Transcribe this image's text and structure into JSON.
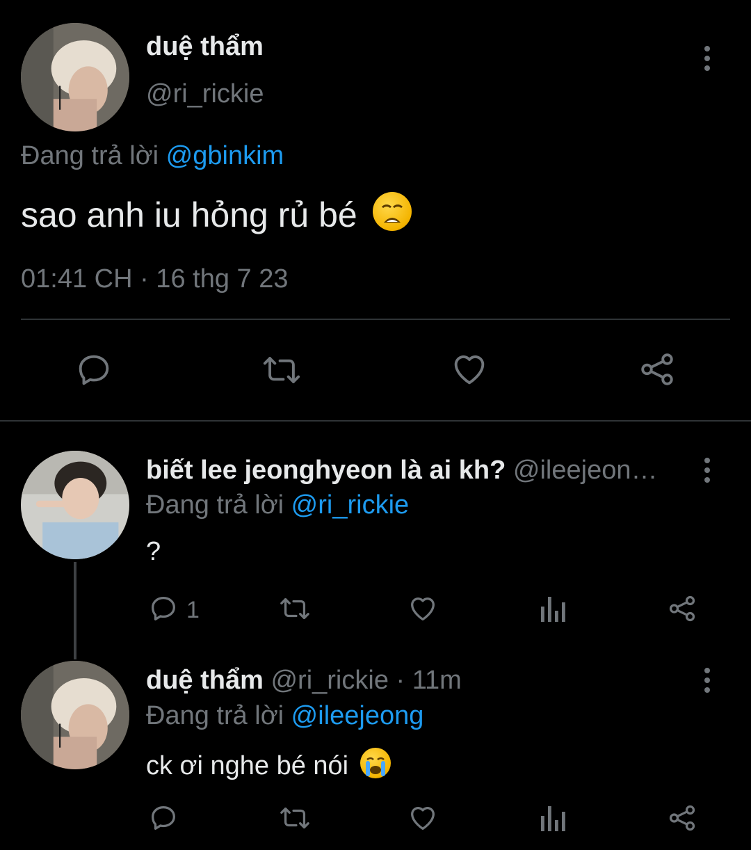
{
  "main_tweet": {
    "display_name": "duệ thẩm",
    "handle": "@ri_rickie",
    "replying_label": "Đang trả lời",
    "replying_to": "@gbinkim",
    "text": "sao anh iu hỏng rủ bé",
    "emoji": "weary-face-emoji",
    "timestamp": "01:41 CH · 16 thg 7 23"
  },
  "reply_1": {
    "display_name": "biết lee jeonghyeon là ai kh?",
    "handle": "@ileejeon…",
    "replying_label": "Đang trả lời",
    "replying_to": "@ri_rickie",
    "text": "?",
    "reply_count": "1"
  },
  "reply_2": {
    "display_name": "duệ thẩm",
    "handle": "@ri_rickie",
    "time": "· 11m",
    "replying_label": "Đang trả lời",
    "replying_to": "@ileejeong",
    "text": "ck ơi nghe bé nói",
    "emoji": "crying-face-emoji"
  },
  "colors": {
    "background": "#000000",
    "text": "#e7e9ea",
    "muted": "#71767b",
    "link": "#1d9bf0",
    "divider": "#2f3336"
  },
  "icons": [
    "reply-icon",
    "retweet-icon",
    "like-icon",
    "views-icon",
    "share-icon",
    "more-icon"
  ]
}
